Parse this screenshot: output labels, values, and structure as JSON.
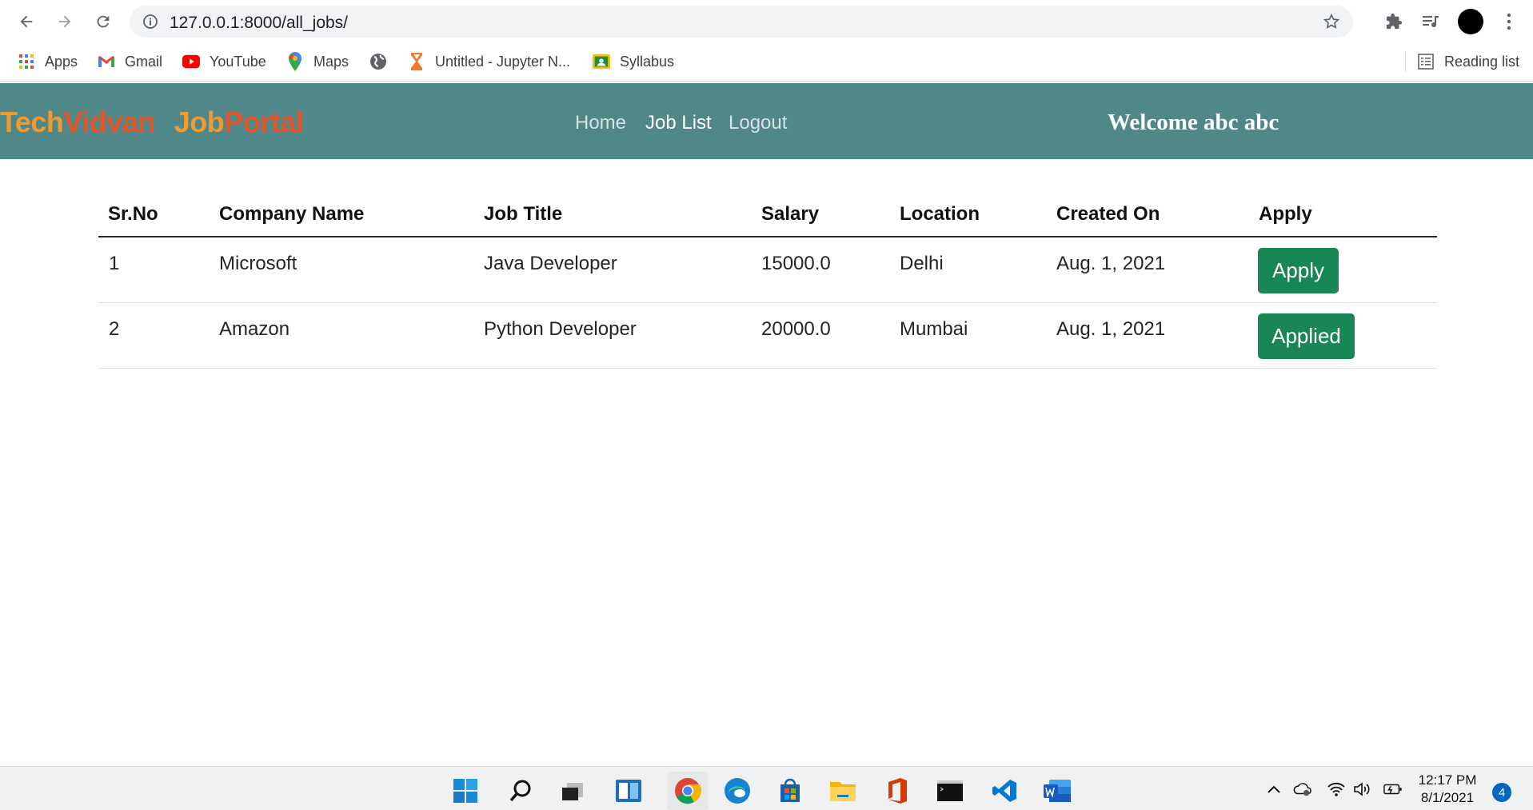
{
  "browser": {
    "url": "127.0.0.1:8000/all_jobs/",
    "bookmarks": [
      {
        "label": "Apps",
        "icon": "apps-grid-icon"
      },
      {
        "label": "Gmail",
        "icon": "gmail-icon"
      },
      {
        "label": "YouTube",
        "icon": "youtube-icon"
      },
      {
        "label": "Maps",
        "icon": "maps-icon"
      },
      {
        "label": "",
        "icon": "globe-icon"
      },
      {
        "label": "Untitled - Jupyter N...",
        "icon": "jupyter-icon"
      },
      {
        "label": "Syllabus",
        "icon": "classroom-icon"
      }
    ],
    "reading_list": "Reading list"
  },
  "site": {
    "brand": {
      "part1a": "Tech",
      "part1b": "Vidvan",
      "part2a": "Job",
      "part2b": "Portal"
    },
    "nav": {
      "home": "Home",
      "job_list": "Job List",
      "logout": "Logout"
    },
    "welcome": "Welcome abc abc",
    "colors": {
      "navbar": "#508789",
      "button": "#198754",
      "brand_orange": "#f29a2e",
      "brand_red": "#e2542a"
    }
  },
  "table": {
    "headers": [
      "Sr.No",
      "Company Name",
      "Job Title",
      "Salary",
      "Location",
      "Created On",
      "Apply"
    ],
    "rows": [
      {
        "sr": "1",
        "company": "Microsoft",
        "title": "Java Developer",
        "salary": "15000.0",
        "location": "Delhi",
        "created": "Aug. 1, 2021",
        "action": "Apply"
      },
      {
        "sr": "2",
        "company": "Amazon",
        "title": "Python Developer",
        "salary": "20000.0",
        "location": "Mumbai",
        "created": "Aug. 1, 2021",
        "action": "Applied"
      }
    ]
  },
  "taskbar": {
    "time": "12:17 PM",
    "date": "8/1/2021",
    "notifications": "4"
  }
}
